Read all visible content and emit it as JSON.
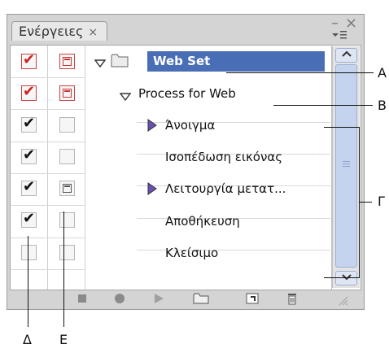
{
  "panel": {
    "tab_label": "Ενέργειες",
    "tab_close": "×",
    "minimize": "–",
    "close": "×",
    "menu": "▾≡"
  },
  "actions": {
    "set_name": "Web Set",
    "action_name": "Process for Web",
    "steps": [
      "Άνοιγμα",
      "Ισοπέδωση εικόνας",
      "Λειτουργία μετατ...",
      "Αποθήκευση",
      "Κλείσιμο"
    ]
  },
  "colors": {
    "selection": "#4a6eb5",
    "red_check": "#cc2222",
    "black_check": "#111111"
  },
  "toolbar": {
    "icons": [
      "stop-icon",
      "record-icon",
      "play-icon",
      "new-set-icon",
      "new-action-icon",
      "delete-icon"
    ]
  },
  "callouts": {
    "A": "A",
    "B": "B",
    "G": "Γ",
    "D": "Δ",
    "E": "E"
  }
}
